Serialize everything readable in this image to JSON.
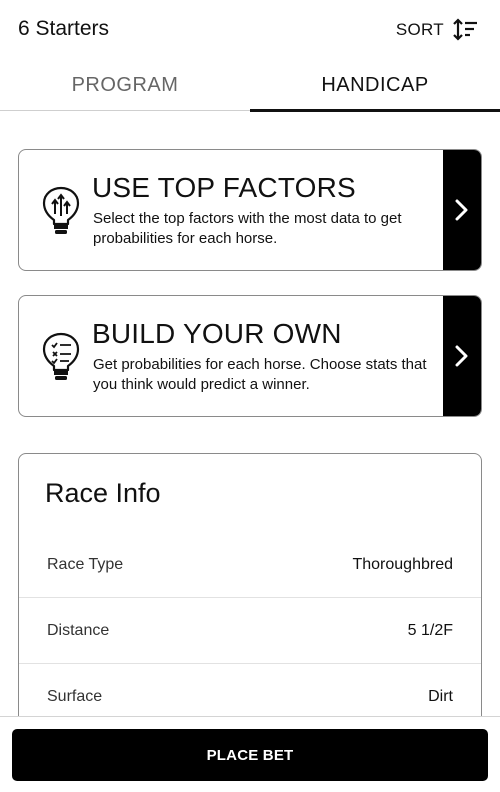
{
  "header": {
    "starters_label": "6 Starters",
    "sort_label": "SORT",
    "sort_icon": "sort-icon"
  },
  "tabs": [
    {
      "label": "PROGRAM",
      "active": false
    },
    {
      "label": "HANDICAP",
      "active": true
    }
  ],
  "options": [
    {
      "title": "USE TOP FACTORS",
      "description": "Select the top factors with the most data to get probabilities for each horse.",
      "icon": "lightbulb-factors-icon",
      "action_icon": "chevron-right-icon"
    },
    {
      "title": "BUILD YOUR OWN",
      "description": "Get probabilities for each horse. Choose stats that you think would predict a winner.",
      "icon": "lightbulb-checklist-icon",
      "action_icon": "chevron-right-icon"
    }
  ],
  "race_info": {
    "title": "Race Info",
    "rows": [
      {
        "label": "Race Type",
        "value": "Thoroughbred"
      },
      {
        "label": "Distance",
        "value": "5 1/2F"
      },
      {
        "label": "Surface",
        "value": "Dirt"
      }
    ]
  },
  "footer": {
    "place_bet_label": "PLACE BET"
  },
  "colors": {
    "primary": "#000000",
    "background": "#ffffff",
    "border": "#8a8a8a",
    "inactive_text": "#666666"
  }
}
